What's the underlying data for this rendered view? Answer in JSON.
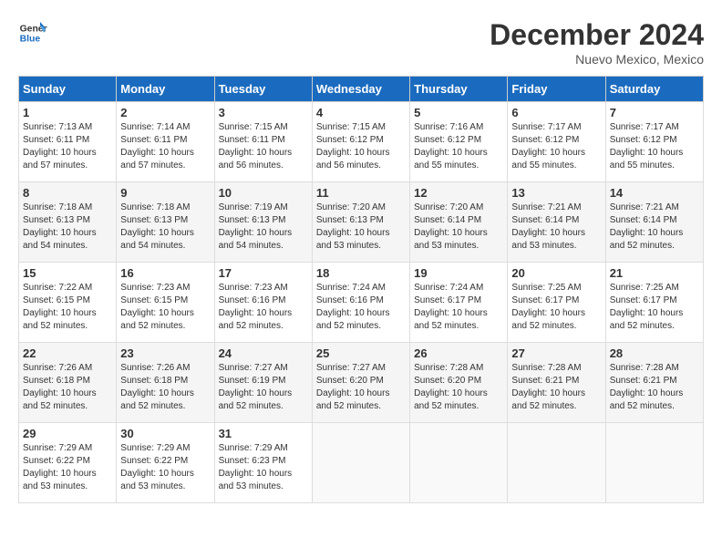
{
  "header": {
    "logo_line1": "General",
    "logo_line2": "Blue",
    "month": "December 2024",
    "location": "Nuevo Mexico, Mexico"
  },
  "days_of_week": [
    "Sunday",
    "Monday",
    "Tuesday",
    "Wednesday",
    "Thursday",
    "Friday",
    "Saturday"
  ],
  "weeks": [
    [
      {
        "day": "1",
        "rise": "7:13 AM",
        "set": "6:11 PM",
        "daylight": "10 hours and 57 minutes."
      },
      {
        "day": "2",
        "rise": "7:14 AM",
        "set": "6:11 PM",
        "daylight": "10 hours and 57 minutes."
      },
      {
        "day": "3",
        "rise": "7:15 AM",
        "set": "6:11 PM",
        "daylight": "10 hours and 56 minutes."
      },
      {
        "day": "4",
        "rise": "7:15 AM",
        "set": "6:12 PM",
        "daylight": "10 hours and 56 minutes."
      },
      {
        "day": "5",
        "rise": "7:16 AM",
        "set": "6:12 PM",
        "daylight": "10 hours and 55 minutes."
      },
      {
        "day": "6",
        "rise": "7:17 AM",
        "set": "6:12 PM",
        "daylight": "10 hours and 55 minutes."
      },
      {
        "day": "7",
        "rise": "7:17 AM",
        "set": "6:12 PM",
        "daylight": "10 hours and 55 minutes."
      }
    ],
    [
      {
        "day": "8",
        "rise": "7:18 AM",
        "set": "6:13 PM",
        "daylight": "10 hours and 54 minutes."
      },
      {
        "day": "9",
        "rise": "7:18 AM",
        "set": "6:13 PM",
        "daylight": "10 hours and 54 minutes."
      },
      {
        "day": "10",
        "rise": "7:19 AM",
        "set": "6:13 PM",
        "daylight": "10 hours and 54 minutes."
      },
      {
        "day": "11",
        "rise": "7:20 AM",
        "set": "6:13 PM",
        "daylight": "10 hours and 53 minutes."
      },
      {
        "day": "12",
        "rise": "7:20 AM",
        "set": "6:14 PM",
        "daylight": "10 hours and 53 minutes."
      },
      {
        "day": "13",
        "rise": "7:21 AM",
        "set": "6:14 PM",
        "daylight": "10 hours and 53 minutes."
      },
      {
        "day": "14",
        "rise": "7:21 AM",
        "set": "6:14 PM",
        "daylight": "10 hours and 52 minutes."
      }
    ],
    [
      {
        "day": "15",
        "rise": "7:22 AM",
        "set": "6:15 PM",
        "daylight": "10 hours and 52 minutes."
      },
      {
        "day": "16",
        "rise": "7:23 AM",
        "set": "6:15 PM",
        "daylight": "10 hours and 52 minutes."
      },
      {
        "day": "17",
        "rise": "7:23 AM",
        "set": "6:16 PM",
        "daylight": "10 hours and 52 minutes."
      },
      {
        "day": "18",
        "rise": "7:24 AM",
        "set": "6:16 PM",
        "daylight": "10 hours and 52 minutes."
      },
      {
        "day": "19",
        "rise": "7:24 AM",
        "set": "6:17 PM",
        "daylight": "10 hours and 52 minutes."
      },
      {
        "day": "20",
        "rise": "7:25 AM",
        "set": "6:17 PM",
        "daylight": "10 hours and 52 minutes."
      },
      {
        "day": "21",
        "rise": "7:25 AM",
        "set": "6:17 PM",
        "daylight": "10 hours and 52 minutes."
      }
    ],
    [
      {
        "day": "22",
        "rise": "7:26 AM",
        "set": "6:18 PM",
        "daylight": "10 hours and 52 minutes."
      },
      {
        "day": "23",
        "rise": "7:26 AM",
        "set": "6:18 PM",
        "daylight": "10 hours and 52 minutes."
      },
      {
        "day": "24",
        "rise": "7:27 AM",
        "set": "6:19 PM",
        "daylight": "10 hours and 52 minutes."
      },
      {
        "day": "25",
        "rise": "7:27 AM",
        "set": "6:20 PM",
        "daylight": "10 hours and 52 minutes."
      },
      {
        "day": "26",
        "rise": "7:28 AM",
        "set": "6:20 PM",
        "daylight": "10 hours and 52 minutes."
      },
      {
        "day": "27",
        "rise": "7:28 AM",
        "set": "6:21 PM",
        "daylight": "10 hours and 52 minutes."
      },
      {
        "day": "28",
        "rise": "7:28 AM",
        "set": "6:21 PM",
        "daylight": "10 hours and 52 minutes."
      }
    ],
    [
      {
        "day": "29",
        "rise": "7:29 AM",
        "set": "6:22 PM",
        "daylight": "10 hours and 53 minutes."
      },
      {
        "day": "30",
        "rise": "7:29 AM",
        "set": "6:22 PM",
        "daylight": "10 hours and 53 minutes."
      },
      {
        "day": "31",
        "rise": "7:29 AM",
        "set": "6:23 PM",
        "daylight": "10 hours and 53 minutes."
      },
      null,
      null,
      null,
      null
    ]
  ]
}
